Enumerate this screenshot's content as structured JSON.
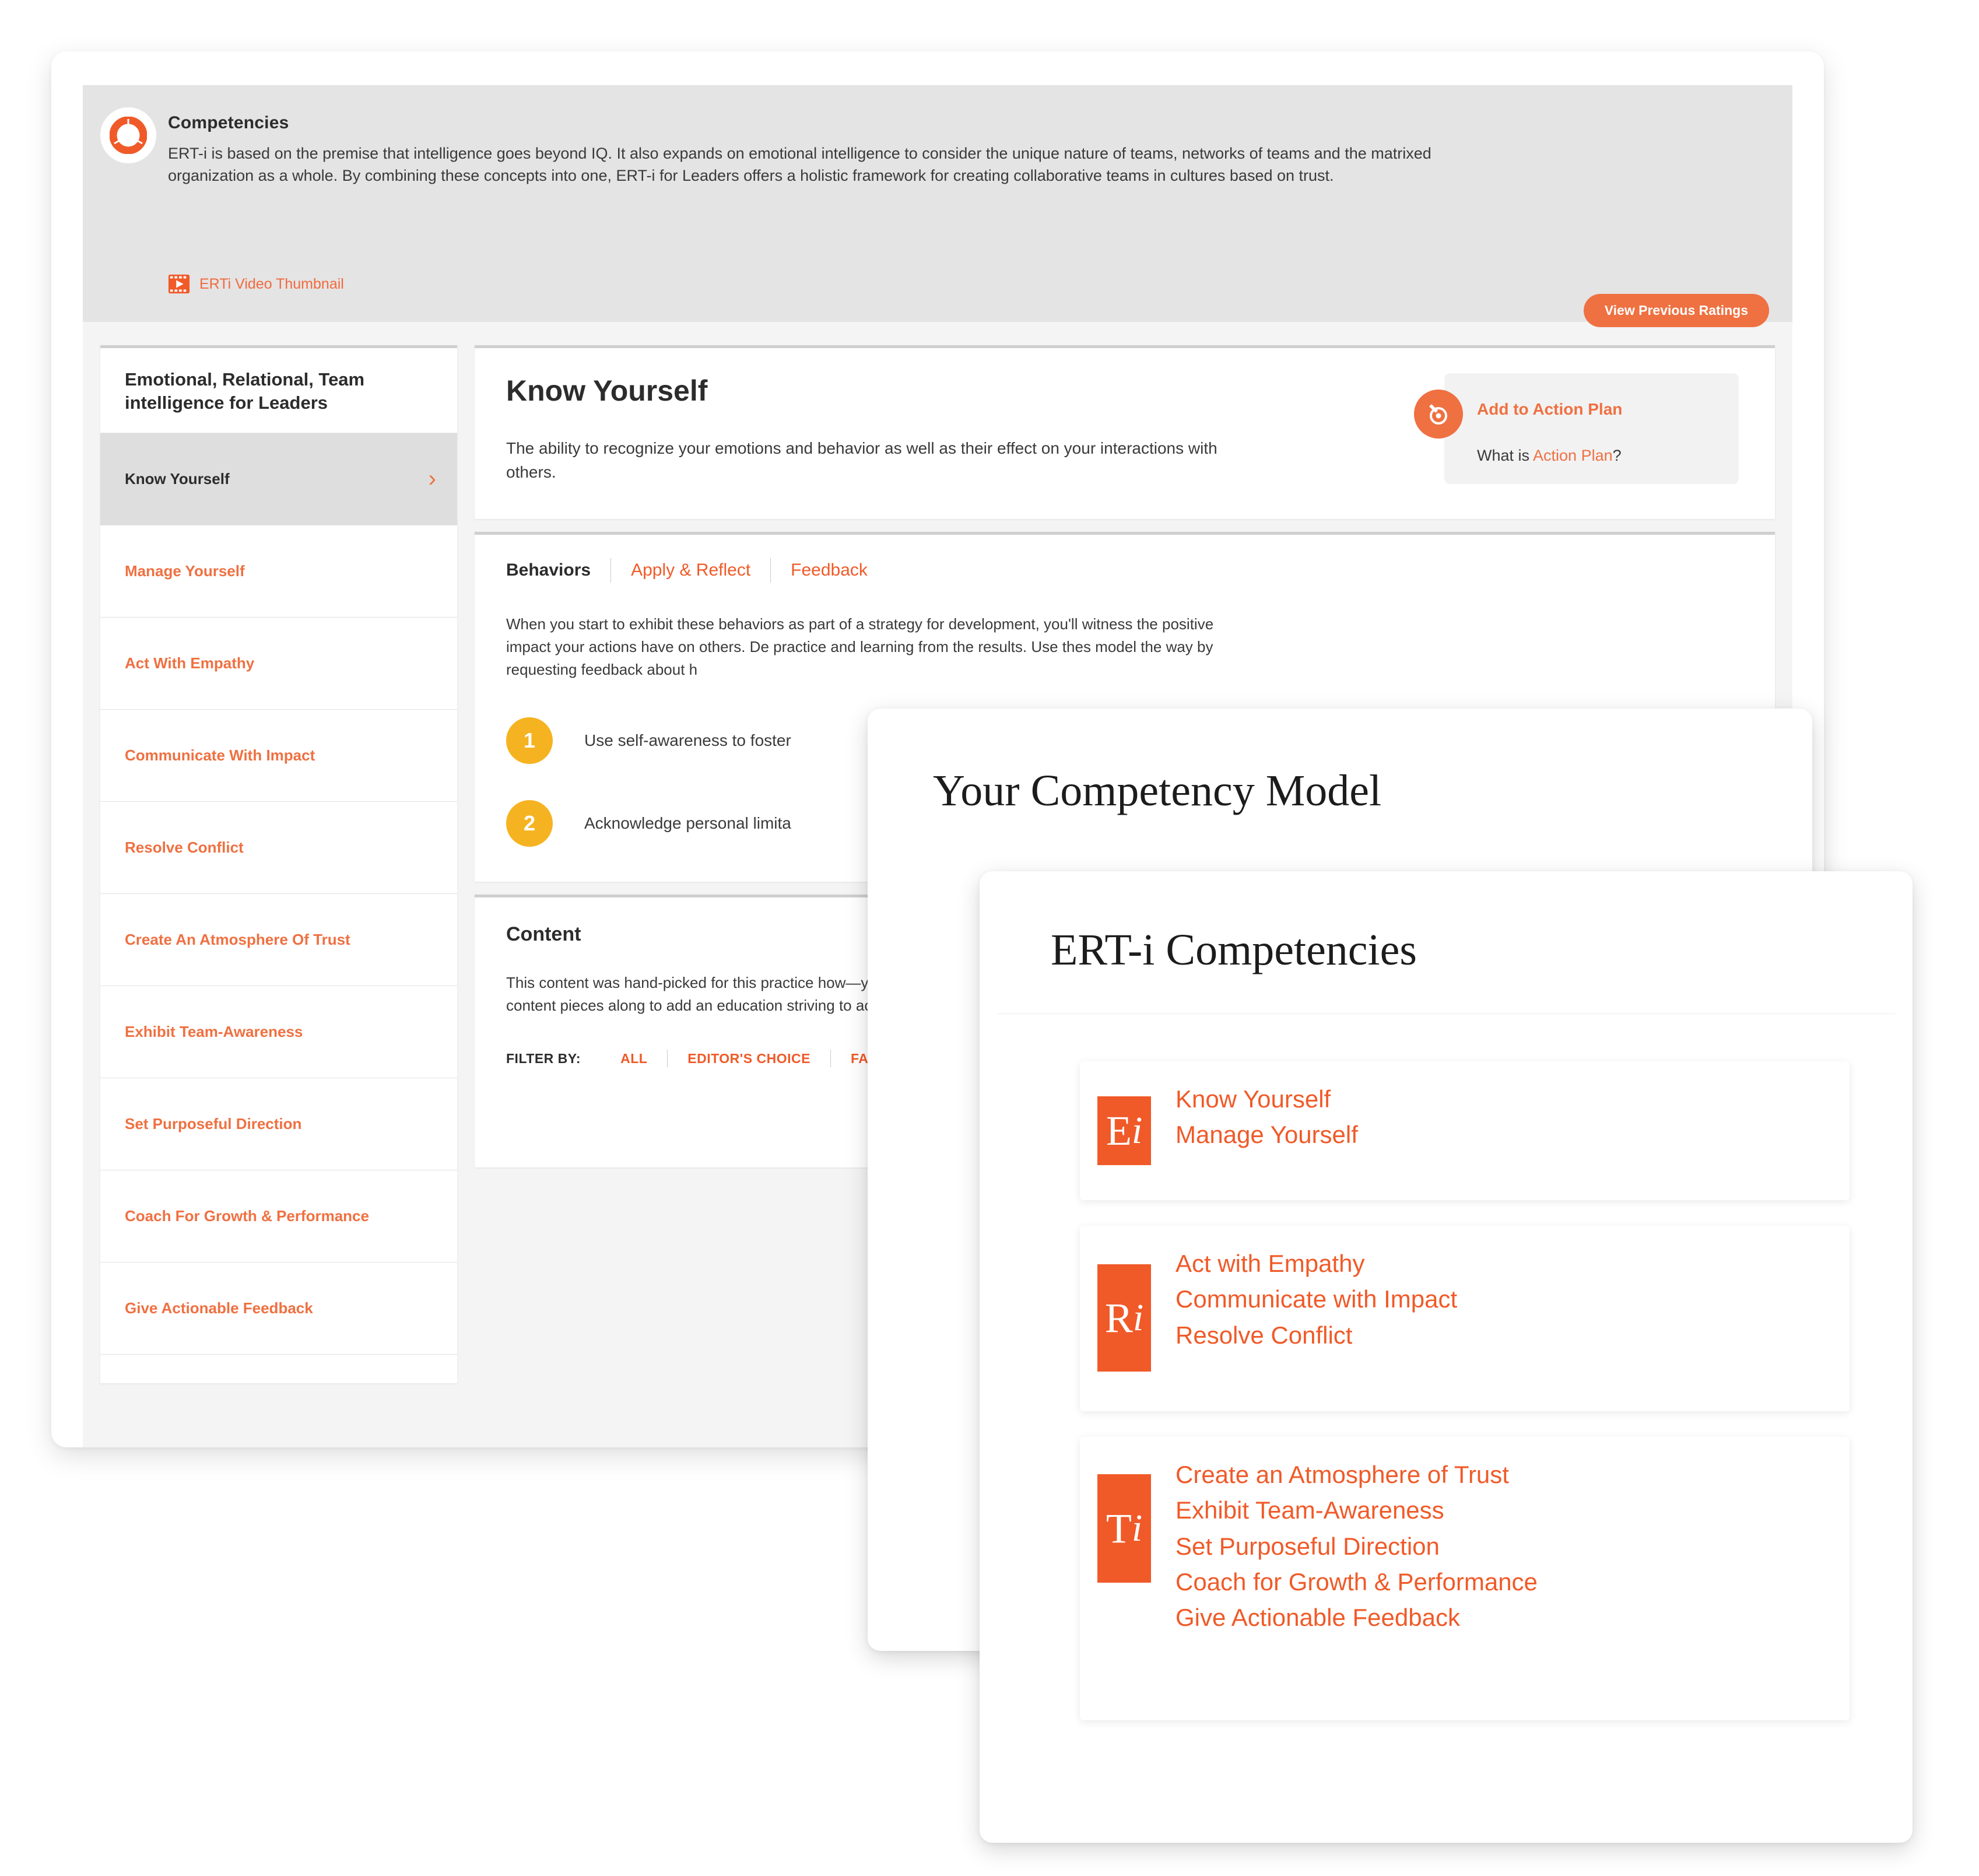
{
  "banner": {
    "title": "Competencies",
    "body": "ERT-i is based on the premise that intelligence goes beyond IQ. It also expands on emotional intelligence to consider the unique nature of teams, networks of teams and the matrixed organization as a whole. By combining these concepts into one, ERT-i for Leaders offers a holistic framework for creating collaborative teams in cultures based on trust.",
    "video_link": "ERTi Video Thumbnail",
    "video_icon": "film-play-icon",
    "logo_icon": "competencies-donut-icon",
    "previous_ratings_button": "View Previous Ratings"
  },
  "sidebar": {
    "title": "Emotional, Relational, Team intelligence for Leaders",
    "chevron_icon": "chevron-right-icon",
    "items": [
      {
        "label": "Know Yourself",
        "active": true
      },
      {
        "label": "Manage Yourself",
        "active": false
      },
      {
        "label": "Act With Empathy",
        "active": false
      },
      {
        "label": "Communicate With Impact",
        "active": false
      },
      {
        "label": "Resolve Conflict",
        "active": false
      },
      {
        "label": "Create An Atmosphere Of Trust",
        "active": false
      },
      {
        "label": "Exhibit Team-Awareness",
        "active": false
      },
      {
        "label": "Set Purposeful Direction",
        "active": false
      },
      {
        "label": "Coach For Growth & Performance",
        "active": false
      },
      {
        "label": "Give Actionable Feedback",
        "active": false
      }
    ]
  },
  "detail": {
    "title": "Know Yourself",
    "description": "The ability to recognize your emotions and behavior as well as their effect on your interactions with others.",
    "action_card": {
      "icon": "target-pin-icon",
      "link_label": "Add to Action Plan",
      "what_prefix": "What is ",
      "what_highlight": "Action Plan",
      "what_suffix": "?"
    },
    "tabs": [
      {
        "label": "Behaviors",
        "active": true
      },
      {
        "label": "Apply & Reflect",
        "active": false
      },
      {
        "label": "Feedback",
        "active": false
      }
    ],
    "behaviors_intro": "When you start to exhibit these behaviors as part of a strategy for development, you'll witness the positive impact your actions have on others. De practice and learning from the results. Use thes model the way by requesting feedback about h",
    "behaviors": [
      {
        "number": "1",
        "text": "Use self-awareness to foster"
      },
      {
        "number": "2",
        "text": "Acknowledge personal limita"
      }
    ]
  },
  "content_section": {
    "title": "Content",
    "description": "This content was hand-picked for this practice how—you should build efficacy in this area. Add these content pieces along to add an education striving to achieve.",
    "filter_label": "FILTER BY:",
    "filter_options": [
      "ALL",
      "EDITOR'S CHOICE",
      "FAVORIT"
    ],
    "search_caret_icon": "caret-down-icon"
  },
  "overlay_model": {
    "title": "Your Competency Model"
  },
  "overlay_competencies": {
    "title": "ERT-i Competencies",
    "groups": [
      {
        "badge_letter": "E",
        "badge_sub": "i",
        "items": [
          "Know Yourself",
          "Manage Yourself"
        ]
      },
      {
        "badge_letter": "R",
        "badge_sub": "i",
        "items": [
          "Act with Empathy",
          "Communicate with Impact",
          "Resolve Conflict"
        ]
      },
      {
        "badge_letter": "T",
        "badge_sub": "i",
        "items": [
          "Create an Atmosphere of Trust",
          "Exhibit Team-Awareness",
          "Set Purposeful Direction",
          "Coach for Growth & Performance",
          "Give Actionable Feedback"
        ]
      }
    ]
  },
  "colors": {
    "accent_orange": "#f05a28",
    "button_orange": "#ef7041",
    "number_yellow": "#f6b321",
    "banner_gray": "#e4e4e4",
    "text_dark": "#2c2c2c"
  }
}
